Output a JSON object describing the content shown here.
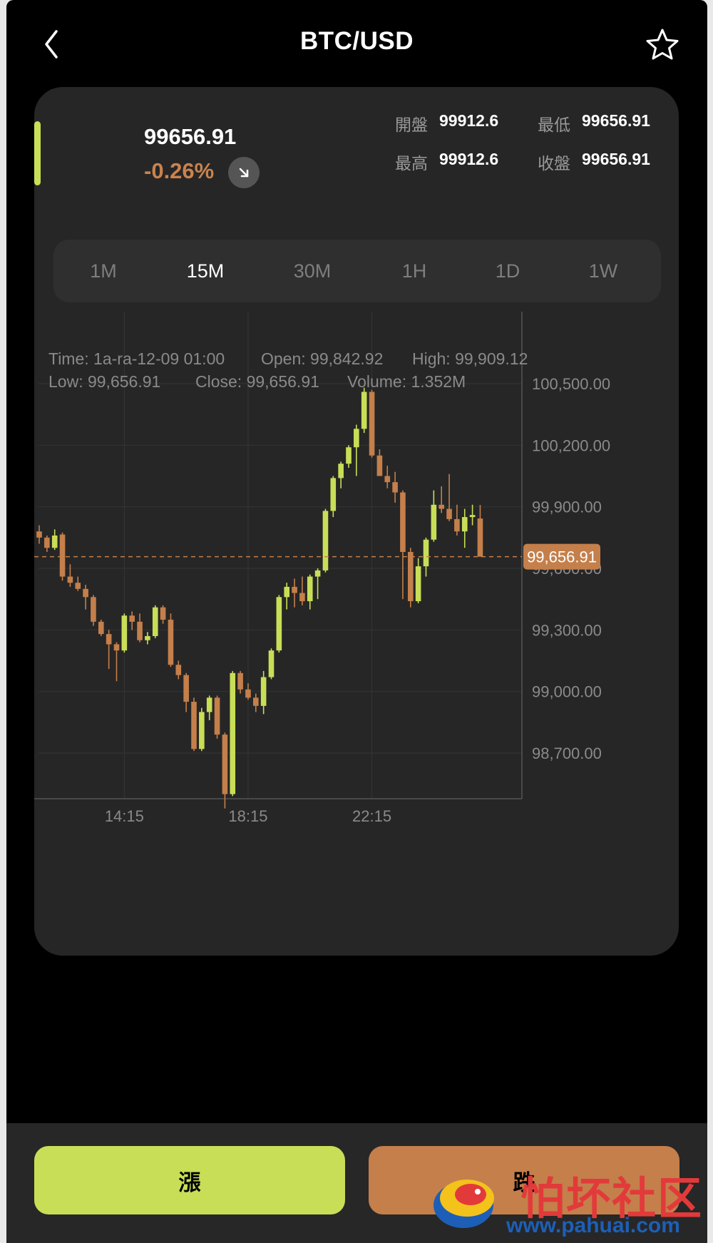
{
  "header": {
    "title": "BTC/USD",
    "back_icon": "chevron-left-icon",
    "favorite_icon": "star-outline-icon"
  },
  "summary": {
    "price": "99656.91",
    "change": "-0.26%",
    "trend_icon": "arrow-down-right-icon",
    "stats": {
      "open_label": "開盤",
      "open_value": "99912.6",
      "low_label": "最低",
      "low_value": "99656.91",
      "high_label": "最高",
      "high_value": "99912.6",
      "close_label": "收盤",
      "close_value": "99656.91"
    }
  },
  "tabs": [
    {
      "label": "1M",
      "active": false
    },
    {
      "label": "15M",
      "active": true
    },
    {
      "label": "30M",
      "active": false
    },
    {
      "label": "1H",
      "active": false
    },
    {
      "label": "1D",
      "active": false
    },
    {
      "label": "1W",
      "active": false
    }
  ],
  "tooltip": {
    "line1": [
      "Time: 1a-ra-12-09 01:00",
      "Open: 99,842.92",
      "High: 99,909.12"
    ],
    "line2": [
      "Low: 99,656.91",
      "Close: 99,656.91",
      "Volume: 1.352M"
    ]
  },
  "chart_data": {
    "type": "candlestick",
    "y_ticks": [
      "100,500.00",
      "100,200.00",
      "99,900.00",
      "99,600.00",
      "99,300.00",
      "99,000.00",
      "98,700.00"
    ],
    "y_tick_values": [
      100500,
      100200,
      99900,
      99600,
      99300,
      99000,
      98700
    ],
    "x_ticks": [
      "14:15",
      "18:15",
      "22:15"
    ],
    "x_tick_index": [
      11,
      27,
      43
    ],
    "current_price_label": "99,656.91",
    "current_price": 99656.91,
    "colors": {
      "up": "#c9de57",
      "down": "#c47f4b",
      "grid": "#353535",
      "axis": "#555555",
      "label": "#8a8a8a"
    },
    "candles": [
      {
        "o": 99780,
        "h": 99810,
        "l": 99720,
        "c": 99750
      },
      {
        "o": 99750,
        "h": 99760,
        "l": 99680,
        "c": 99700
      },
      {
        "o": 99700,
        "h": 99790,
        "l": 99690,
        "c": 99760
      },
      {
        "o": 99765,
        "h": 99775,
        "l": 99540,
        "c": 99560
      },
      {
        "o": 99560,
        "h": 99620,
        "l": 99510,
        "c": 99530
      },
      {
        "o": 99530,
        "h": 99560,
        "l": 99490,
        "c": 99500
      },
      {
        "o": 99500,
        "h": 99520,
        "l": 99400,
        "c": 99460
      },
      {
        "o": 99460,
        "h": 99470,
        "l": 99320,
        "c": 99340
      },
      {
        "o": 99340,
        "h": 99350,
        "l": 99270,
        "c": 99280
      },
      {
        "o": 99280,
        "h": 99300,
        "l": 99110,
        "c": 99230
      },
      {
        "o": 99230,
        "h": 99240,
        "l": 99050,
        "c": 99200
      },
      {
        "o": 99200,
        "h": 99380,
        "l": 99190,
        "c": 99370
      },
      {
        "o": 99370,
        "h": 99390,
        "l": 99300,
        "c": 99340
      },
      {
        "o": 99340,
        "h": 99380,
        "l": 99240,
        "c": 99250
      },
      {
        "o": 99250,
        "h": 99290,
        "l": 99230,
        "c": 99270
      },
      {
        "o": 99270,
        "h": 99420,
        "l": 99260,
        "c": 99410
      },
      {
        "o": 99410,
        "h": 99420,
        "l": 99330,
        "c": 99350
      },
      {
        "o": 99350,
        "h": 99380,
        "l": 99120,
        "c": 99130
      },
      {
        "o": 99130,
        "h": 99150,
        "l": 99060,
        "c": 99080
      },
      {
        "o": 99080,
        "h": 99090,
        "l": 98900,
        "c": 98950
      },
      {
        "o": 98950,
        "h": 98970,
        "l": 98710,
        "c": 98720
      },
      {
        "o": 98720,
        "h": 98920,
        "l": 98710,
        "c": 98900
      },
      {
        "o": 98900,
        "h": 98980,
        "l": 98860,
        "c": 98970
      },
      {
        "o": 98970,
        "h": 98980,
        "l": 98770,
        "c": 98790
      },
      {
        "o": 98790,
        "h": 98800,
        "l": 98430,
        "c": 98500
      },
      {
        "o": 98500,
        "h": 99100,
        "l": 98490,
        "c": 99090
      },
      {
        "o": 99090,
        "h": 99100,
        "l": 98990,
        "c": 99010
      },
      {
        "o": 99010,
        "h": 99040,
        "l": 98960,
        "c": 98970
      },
      {
        "o": 98970,
        "h": 98990,
        "l": 98900,
        "c": 98930
      },
      {
        "o": 98930,
        "h": 99100,
        "l": 98890,
        "c": 99070
      },
      {
        "o": 99070,
        "h": 99210,
        "l": 99060,
        "c": 99200
      },
      {
        "o": 99200,
        "h": 99470,
        "l": 99190,
        "c": 99460
      },
      {
        "o": 99460,
        "h": 99530,
        "l": 99400,
        "c": 99510
      },
      {
        "o": 99510,
        "h": 99550,
        "l": 99410,
        "c": 99480
      },
      {
        "o": 99480,
        "h": 99560,
        "l": 99420,
        "c": 99440
      },
      {
        "o": 99440,
        "h": 99570,
        "l": 99400,
        "c": 99560
      },
      {
        "o": 99560,
        "h": 99600,
        "l": 99450,
        "c": 99590
      },
      {
        "o": 99590,
        "h": 99890,
        "l": 99580,
        "c": 99880
      },
      {
        "o": 99880,
        "h": 100050,
        "l": 99850,
        "c": 100040
      },
      {
        "o": 100040,
        "h": 100120,
        "l": 99990,
        "c": 100110
      },
      {
        "o": 100110,
        "h": 100200,
        "l": 100090,
        "c": 100190
      },
      {
        "o": 100190,
        "h": 100300,
        "l": 100050,
        "c": 100280
      },
      {
        "o": 100280,
        "h": 100480,
        "l": 100260,
        "c": 100460
      },
      {
        "o": 100460,
        "h": 100470,
        "l": 100140,
        "c": 100150
      },
      {
        "o": 100150,
        "h": 100180,
        "l": 100050,
        "c": 100050
      },
      {
        "o": 100050,
        "h": 100100,
        "l": 99990,
        "c": 100020
      },
      {
        "o": 100020,
        "h": 100070,
        "l": 99920,
        "c": 99970
      },
      {
        "o": 99970,
        "h": 99980,
        "l": 99450,
        "c": 99680
      },
      {
        "o": 99680,
        "h": 99700,
        "l": 99410,
        "c": 99440
      },
      {
        "o": 99440,
        "h": 99650,
        "l": 99430,
        "c": 99610
      },
      {
        "o": 99610,
        "h": 99750,
        "l": 99560,
        "c": 99740
      },
      {
        "o": 99740,
        "h": 99980,
        "l": 99730,
        "c": 99910
      },
      {
        "o": 99910,
        "h": 100000,
        "l": 99870,
        "c": 99890
      },
      {
        "o": 99890,
        "h": 100060,
        "l": 99830,
        "c": 99840
      },
      {
        "o": 99840,
        "h": 99910,
        "l": 99760,
        "c": 99780
      },
      {
        "o": 99780,
        "h": 99890,
        "l": 99700,
        "c": 99850
      },
      {
        "o": 99850,
        "h": 99910,
        "l": 99810,
        "c": 99860
      },
      {
        "o": 99842.92,
        "h": 99909.12,
        "l": 99656.91,
        "c": 99656.91
      }
    ]
  },
  "actions": {
    "up_label": "漲",
    "down_label": "跌"
  },
  "watermark": {
    "text": "怕坏社区",
    "url": "www.pahuai.com"
  }
}
